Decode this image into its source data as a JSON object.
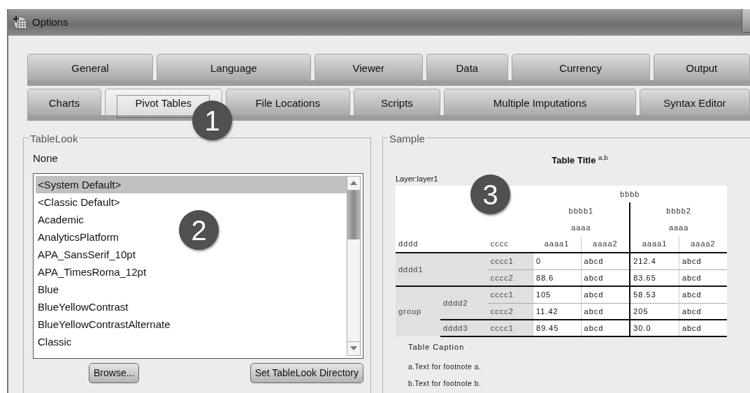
{
  "window": {
    "title": "Options"
  },
  "tab_rows": [
    [
      {
        "label": "General",
        "selected": false
      },
      {
        "label": "Language",
        "selected": false
      },
      {
        "label": "Viewer",
        "selected": false
      },
      {
        "label": "Data",
        "selected": false
      },
      {
        "label": "Currency",
        "selected": false
      },
      {
        "label": "Output",
        "selected": false
      }
    ],
    [
      {
        "label": "Charts",
        "selected": false
      },
      {
        "label": "Pivot Tables",
        "selected": true
      },
      {
        "label": "File Locations",
        "selected": false
      },
      {
        "label": "Scripts",
        "selected": false
      },
      {
        "label": "Multiple Imputations",
        "selected": false
      },
      {
        "label": "Syntax Editor",
        "selected": false
      }
    ]
  ],
  "tablelook": {
    "legend": "TableLook",
    "current": "None",
    "items": [
      {
        "label": "<System Default>",
        "selected": true
      },
      {
        "label": "<Classic Default>",
        "selected": false
      },
      {
        "label": "Academic",
        "selected": false
      },
      {
        "label": "AnalyticsPlatform",
        "selected": false
      },
      {
        "label": "APA_SansSerif_10pt",
        "selected": false
      },
      {
        "label": "APA_TimesRoma_12pt",
        "selected": false
      },
      {
        "label": "Blue",
        "selected": false
      },
      {
        "label": "BlueYellowContrast",
        "selected": false
      },
      {
        "label": "BlueYellowContrastAlternate",
        "selected": false
      },
      {
        "label": "Classic",
        "selected": false
      }
    ],
    "buttons": [
      "Browse...",
      "Set TableLook Directory"
    ]
  },
  "sample": {
    "legend": "Sample",
    "title": "Table Title $^{a,b}$",
    "layer": "Layer:layer1",
    "table": {
      "top_header": "bbbb",
      "groups": [
        {
          "label": "bbbb1",
          "sub": "aaaa"
        },
        {
          "label": "bbbb2",
          "sub": "aaaa"
        }
      ],
      "row_dims": [
        "dddd",
        "cccc"
      ],
      "columns": [
        "aaaa1",
        "aaaa2",
        "aaaa1",
        "aaaa2"
      ],
      "row_groups": [
        {
          "label": "dddd1",
          "rows": [
            {
              "label": "cccc1",
              "values": [
                "0",
                "abcd",
                "212.4",
                "abcd"
              ]
            },
            {
              "label": "cccc2",
              "values": [
                "88.6",
                "abcd",
                "83.65",
                "abcd"
              ]
            }
          ]
        },
        {
          "label": "group",
          "children": [
            {
              "label": "dddd2",
              "rows": [
                {
                  "label": "cccc1",
                  "values": [
                    "105",
                    "abcd",
                    "58.53",
                    "abcd"
                  ]
                },
                {
                  "label": "cccc2",
                  "values": [
                    "11.42",
                    "abcd",
                    "205",
                    "abcd"
                  ]
                }
              ]
            },
            {
              "label": "dddd3",
              "rows": [
                {
                  "label": "cccc1",
                  "values": [
                    "89.45",
                    "abcd",
                    "30.0",
                    "abcd"
                  ]
                }
              ]
            }
          ]
        }
      ]
    },
    "caption": "Table Caption",
    "footnotes": [
      "a.Text for footnote a.",
      "b.Text for footnote b."
    ]
  },
  "callouts": [
    {
      "label": "1"
    },
    {
      "label": "2"
    },
    {
      "label": "3"
    }
  ]
}
